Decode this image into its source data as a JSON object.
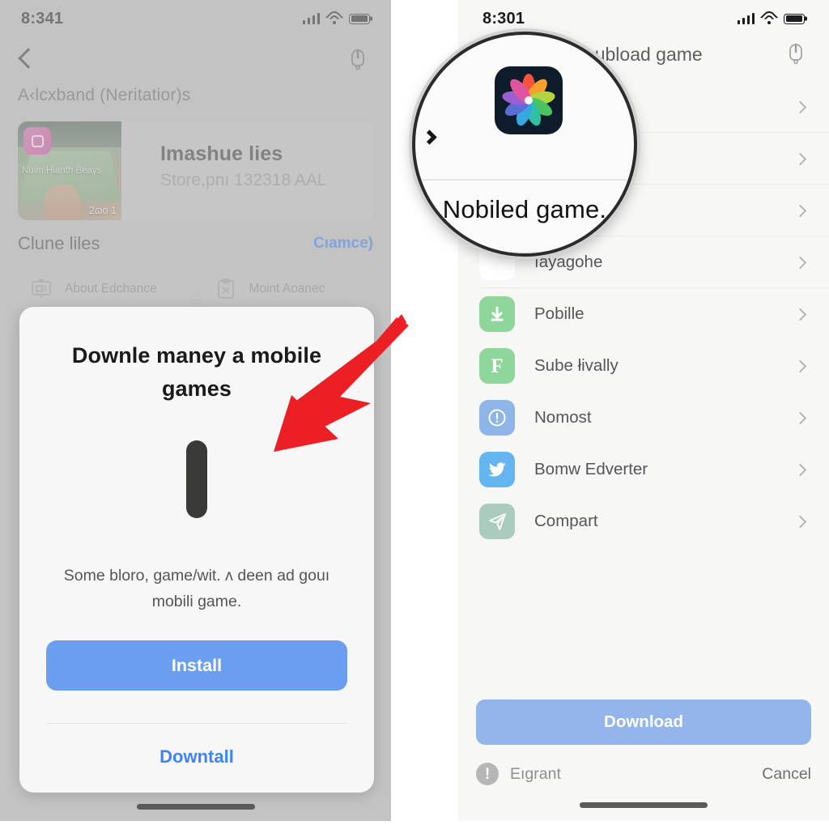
{
  "left_phone": {
    "status_bar": {
      "time": "8:341",
      "signal_icon": "cellular-bars-icon",
      "wifi_icon": "wifi-icon",
      "battery_icon": "battery-full-icon"
    },
    "nav": {
      "back_icon": "back-chevron-icon",
      "power_icon": "power-plug-icon"
    },
    "section_label": "A‹lcxband (Neritatior)s",
    "app_card": {
      "title": "Imashue lies",
      "subtitle": "Store,pnı 132318 AAL",
      "thumb_label": "Nuim Hianth Beays",
      "thumb_number": "2ɷo 1",
      "thumb_badge_icon": "instagram-square-icon"
    },
    "list_header": {
      "title": "Clune liles",
      "action": "Cıamce)"
    },
    "tiles": [
      {
        "label": "About Edchance",
        "icon": "presentation-board-icon"
      },
      {
        "label": "Moint Aoanec",
        "icon": "clipboard-scissors-icon"
      }
    ],
    "dialog": {
      "title": "Downle maney a mobile games",
      "loader_icon": "vertical-pill-loader-icon",
      "body": "Some bloro, game/wit. ʌ deen ad gouı mobili game.",
      "primary_button": "Install",
      "secondary_button": "Downtall"
    },
    "home_indicator_icon": "home-indicator-bar"
  },
  "right_phone": {
    "status_bar": {
      "time": "8:301",
      "signal_icon": "cellular-bars-icon",
      "wifi_icon": "wifi-icon",
      "battery_icon": "battery-full-icon"
    },
    "title": "ʀubload game",
    "power_icon": "power-plug-icon",
    "list": [
      {
        "label": "",
        "icon": "hidden-behind-magnifier-icon",
        "icon_color": "#ffffff",
        "chevron": "chevron-right-icon"
      },
      {
        "label": "",
        "icon": "hidden-behind-magnifier-icon",
        "icon_color": "#ffffff",
        "chevron": "chevron-right-icon"
      },
      {
        "label": "",
        "icon": "hidden-behind-magnifier-icon",
        "icon_color": "#ffffff",
        "chevron": "chevron-right-icon"
      },
      {
        "label": "ıayagohe",
        "icon": "hidden-behind-magnifier-icon",
        "icon_color": "#ffffff",
        "chevron": "chevron-right-icon"
      },
      {
        "label": "Pobille",
        "icon": "download-arrow-icon",
        "icon_color": "#8fd69a",
        "chevron": "chevron-right-icon"
      },
      {
        "label": "Sube łivally",
        "icon": "letter-f-icon",
        "icon_color": "#8fd69a",
        "chevron": "chevron-right-icon"
      },
      {
        "label": "Nomost",
        "icon": "exclamation-circle-icon",
        "icon_color": "#8fb4e8",
        "chevron": "chevron-right-icon"
      },
      {
        "label": "Bomw Edverter",
        "icon": "twitter-bird-icon",
        "icon_color": "#64b5f0",
        "chevron": "chevron-right-icon"
      },
      {
        "label": "Compart",
        "icon": "paper-plane-icon",
        "icon_color": "#a9ccbe",
        "chevron": "chevron-right-icon"
      }
    ],
    "bottom": {
      "download_button": "Download",
      "warning_icon": "exclamation-circle-filled-icon",
      "egrant_label": "Eıgrant",
      "cancel_button": "Cancel"
    },
    "home_indicator_icon": "home-indicator-bar"
  },
  "magnifier": {
    "chevron_icon": "chevron-right-icon",
    "app_icon": "photos-flower-icon",
    "text": "Nobiled game."
  },
  "annotation": {
    "arrow_icon": "red-pointer-arrow-icon",
    "color": "#ec2024"
  },
  "colors": {
    "accent_blue": "#3f84f5",
    "install_button": "#6b9ef0",
    "download_button": "#93b5ec",
    "left_bg": "#c9c9c9",
    "right_bg": "#f7f7f5",
    "arrow_red": "#ec2024"
  }
}
